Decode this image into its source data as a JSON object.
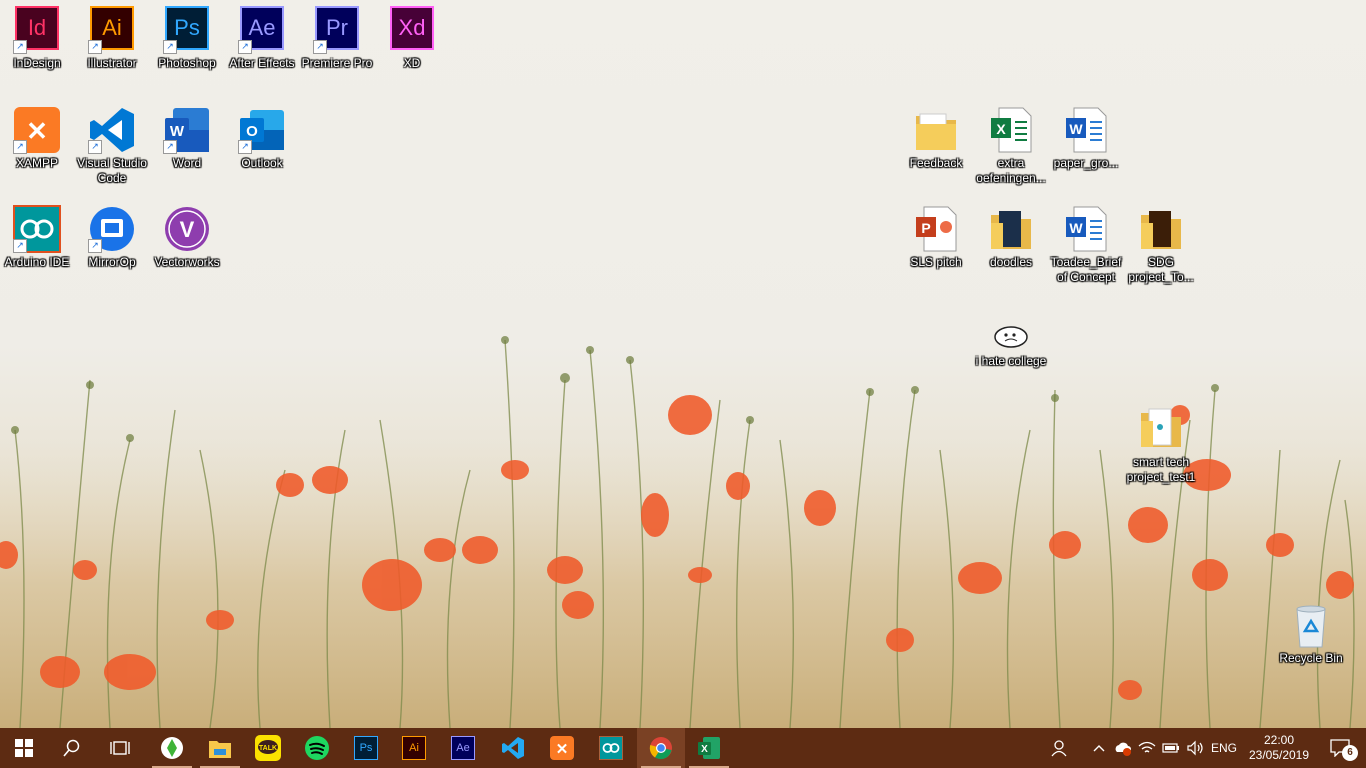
{
  "desktop": {
    "icons_left": [
      {
        "id": "indesign",
        "label": "InDesign",
        "abbr": "Id",
        "bg": "#49021f",
        "fg": "#ff3366"
      },
      {
        "id": "illustrator",
        "label": "Illustrator",
        "abbr": "Ai",
        "bg": "#330000",
        "fg": "#ff9a00"
      },
      {
        "id": "photoshop",
        "label": "Photoshop",
        "abbr": "Ps",
        "bg": "#001e36",
        "fg": "#31a8ff"
      },
      {
        "id": "after-effects",
        "label": "After Effects",
        "abbr": "Ae",
        "bg": "#00005b",
        "fg": "#9999ff"
      },
      {
        "id": "premiere-pro",
        "label": "Premiere Pro",
        "abbr": "Pr",
        "bg": "#00005b",
        "fg": "#9999ff"
      },
      {
        "id": "xd",
        "label": "XD",
        "abbr": "Xd",
        "bg": "#470137",
        "fg": "#ff61f6"
      },
      {
        "id": "xampp",
        "label": "XAMPP"
      },
      {
        "id": "visual-studio-code",
        "label": "Visual Studio Code"
      },
      {
        "id": "word",
        "label": "Word"
      },
      {
        "id": "outlook",
        "label": "Outlook"
      },
      {
        "id": "arduino-ide",
        "label": "Arduino IDE"
      },
      {
        "id": "mirrorop",
        "label": "MirrorOp"
      },
      {
        "id": "vectorworks",
        "label": "Vectorworks"
      }
    ],
    "icons_right": [
      {
        "id": "feedback",
        "label": "Feedback"
      },
      {
        "id": "extra-oefeningen",
        "label": "extra oefeningen..."
      },
      {
        "id": "paper-gro",
        "label": "paper_gro..."
      },
      {
        "id": "sls-pitch",
        "label": "SLS pitch"
      },
      {
        "id": "doodles",
        "label": "doodles"
      },
      {
        "id": "toadee-brief",
        "label": "Toadee_Brief of Concept"
      },
      {
        "id": "sdg-project",
        "label": "SDG project_To..."
      },
      {
        "id": "i-hate-college",
        "label": "i hate college"
      },
      {
        "id": "smart-tech",
        "label": "smart tech project_test1"
      },
      {
        "id": "recycle-bin",
        "label": "Recycle Bin"
      }
    ]
  },
  "taskbar": {
    "pinned": [
      "start",
      "search",
      "task-view",
      "sims",
      "file-explorer",
      "kakaotalk",
      "spotify",
      "photoshop",
      "illustrator",
      "after-effects",
      "vscode",
      "xampp",
      "arduino",
      "chrome",
      "excel"
    ],
    "ps_label": "Ps",
    "ai_label": "Ai",
    "ae_label": "Ae",
    "talk_label": "TALK",
    "language": "ENG",
    "time": "22:00",
    "date": "23/05/2019",
    "notifications": "6"
  }
}
